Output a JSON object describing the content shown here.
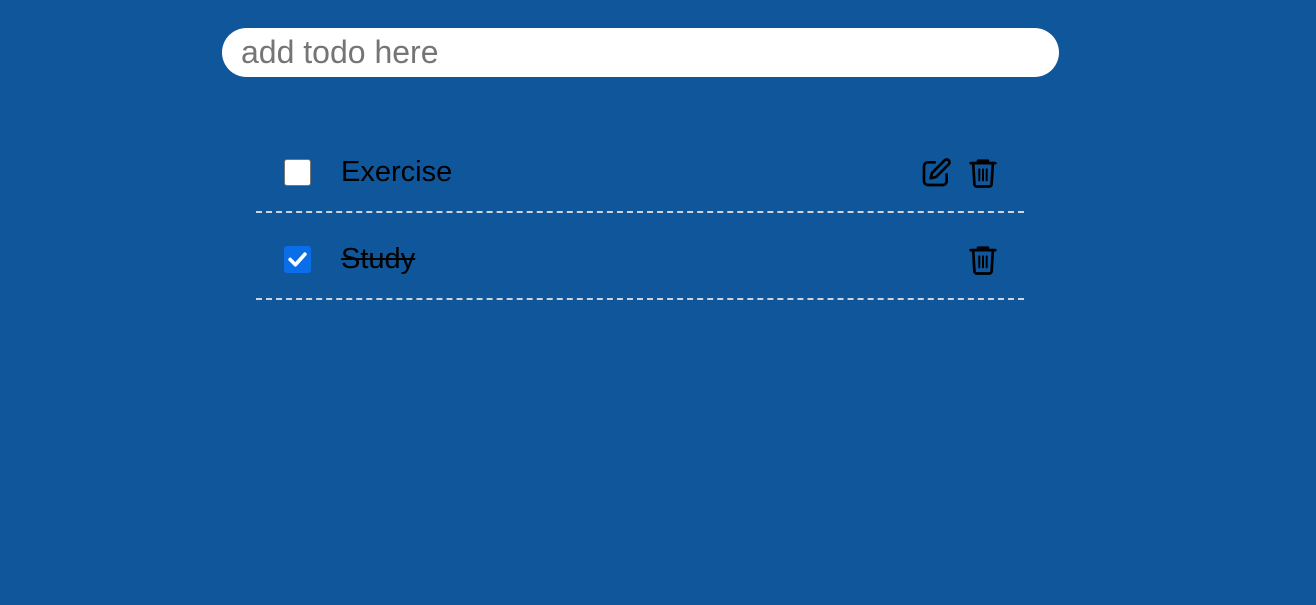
{
  "input": {
    "placeholder": "add todo here",
    "value": ""
  },
  "todos": [
    {
      "label": "Exercise",
      "completed": false,
      "actions": [
        "edit-icon",
        "trash-icon"
      ]
    },
    {
      "label": "Study",
      "completed": true,
      "actions": [
        "trash-icon"
      ]
    }
  ],
  "colors": {
    "background": "#10569a",
    "checked": "#0a6ee8"
  }
}
